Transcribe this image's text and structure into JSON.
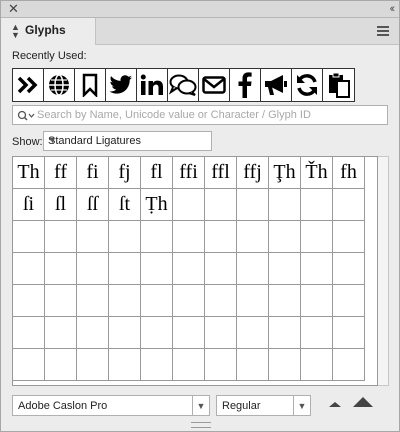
{
  "window": {
    "close_glyph": "✕",
    "collapse_glyph": "‹‹"
  },
  "panel": {
    "tab_title": "Glyphs",
    "menu_icon": "hamburger-menu-icon"
  },
  "recently_used": {
    "label": "Recently Used:",
    "items": [
      "»",
      "globe",
      "bookmark",
      "twitter",
      "linkedin",
      "comments",
      "envelope",
      "facebook",
      "bullhorn",
      "refresh",
      "paste"
    ]
  },
  "search": {
    "placeholder": "Search by Name, Unicode value or Character / Glyph ID"
  },
  "show": {
    "label": "Show:",
    "value": "Standard Ligatures"
  },
  "glyph_grid": {
    "columns": 11,
    "rows": 7,
    "glyphs": [
      "Th",
      "ff",
      "fi",
      "fj",
      "fl",
      "ffi",
      "ffl",
      "ffj",
      "Ţh",
      "Ťh",
      "fh",
      "ſi",
      "ſl",
      "ſſ",
      "ſt",
      "Ṭh"
    ]
  },
  "footer": {
    "font_family": "Adobe Caslon Pro",
    "font_style": "Regular"
  }
}
